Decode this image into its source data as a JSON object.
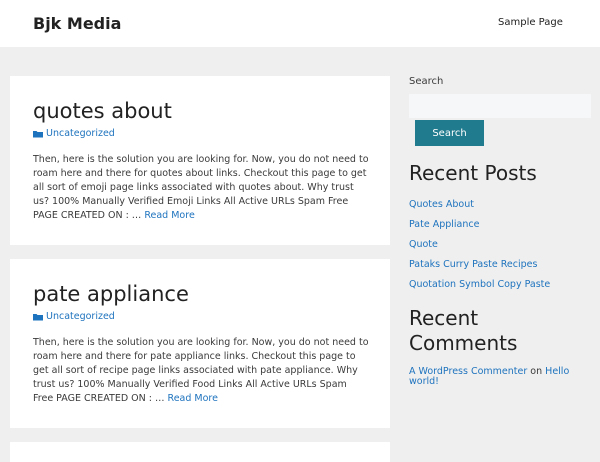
{
  "site": {
    "title": "Bjk Media"
  },
  "nav": {
    "items": [
      {
        "label": "Sample Page"
      }
    ]
  },
  "posts": [
    {
      "title": "quotes about",
      "category": "Uncategorized",
      "excerpt": "Then, here is the solution you are looking for. Now, you do not need to roam here and there for quotes about links. Checkout this page to get all sort of emoji page links associated with quotes about. Why trust us? 100% Manually Verified Emoji Links All Active URLs Spam Free PAGE CREATED ON : …",
      "read_more": "Read More"
    },
    {
      "title": "pate appliance",
      "category": "Uncategorized",
      "excerpt": "Then, here is the solution you are looking for. Now, you do not need to roam here and there for pate appliance links. Checkout this page to get all sort of recipe page links associated with pate appliance. Why trust us? 100% Manually Verified Food Links All Active URLs Spam Free PAGE CREATED ON : …",
      "read_more": "Read More"
    }
  ],
  "sidebar": {
    "search": {
      "label": "Search",
      "placeholder": "",
      "value": "",
      "button_label": "Search"
    },
    "recent_posts": {
      "title": "Recent Posts",
      "items": [
        "Quotes About",
        "Pate Appliance",
        "Quote",
        "Pataks Curry Paste Recipes",
        "Quotation Symbol Copy Paste"
      ]
    },
    "recent_comments": {
      "title": "Recent Comments",
      "items": [
        {
          "author": "A WordPress Commenter",
          "on": "on",
          "post": "Hello world!"
        }
      ]
    }
  },
  "colors": {
    "background": "#efefef",
    "link": "#1e73be",
    "button": "#217b8e",
    "text": "#3a3a3a",
    "heading": "#222222"
  },
  "icons": {
    "category": "folder-icon"
  }
}
